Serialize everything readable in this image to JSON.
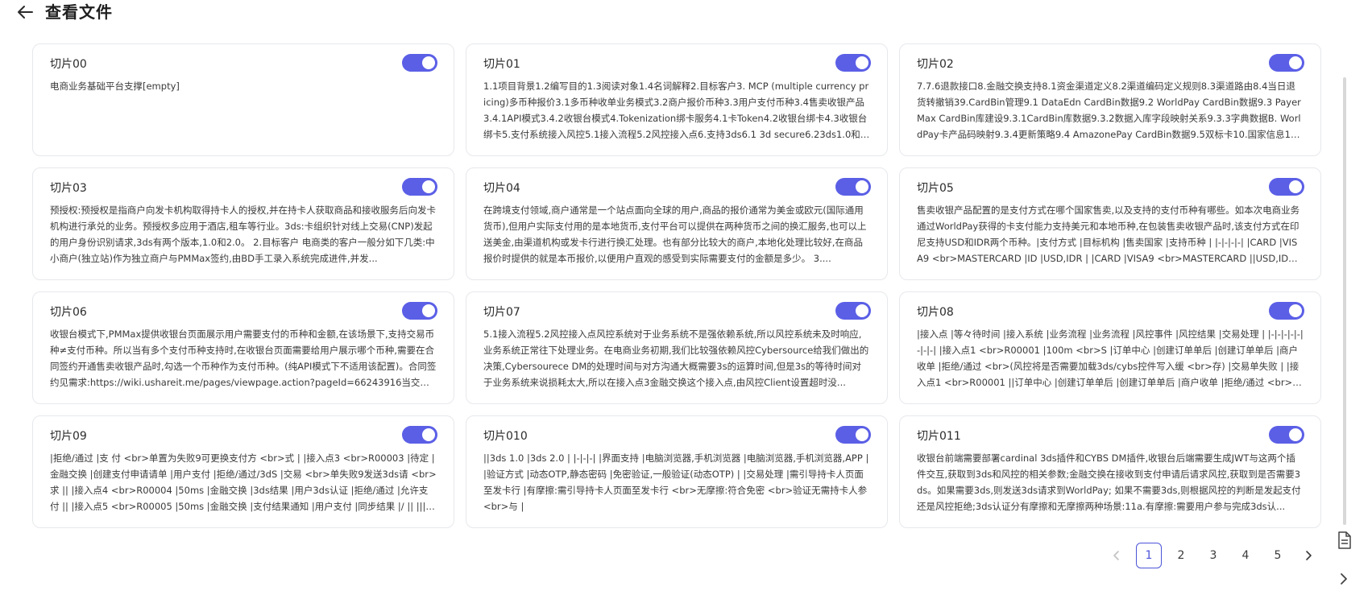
{
  "header": {
    "title": "查看文件"
  },
  "cards": [
    {
      "title": "切片00",
      "enabled": true,
      "text": "电商业务基础平台支撑[empty]"
    },
    {
      "title": "切片01",
      "enabled": true,
      "text": "1.1项目背景1.2编写目的1.3阅读对象1.4名词解释2.目标客户3. MCP (multiple currency pricing)多币种报价3.1多币种收单业务模式3.2商户报价币种3.3用户支付币种3.4售卖收银产品3.4.1API模式3.4.2收银台模式4.Tokenization绑卡服务4.1卡Token4.2收银台绑卡4.3收银台绑卡5.支付系统接入风控5.1接入流程5.2风控接入点6.支持3ds6.1 3d secure6.23ds1.0和2...."
    },
    {
      "title": "切片02",
      "enabled": true,
      "text": "7.7.6退款接口8.金融交换支持8.1资金渠道定义8.2渠道编码定义规则8.3渠道路由8.4当日退货转撤销39.CardBin管理9.1 DataEdn CardBin数据9.2 WorldPay CardBin数据9.3 PayerMax CardBin库建设9.3.1CardBin库数据9.3.2数据入库字段映射关系9.3.3字典数据B. WorldPay卡产品码映射9.3.4更新策略9.4 AmazonePay CardBin数据9.5双标卡10.国家信息10.1国家代..."
    },
    {
      "title": "切片03",
      "enabled": true,
      "text": "预授权:预授权是指商户向发卡机构取得持卡人的授权,并在持卡人获取商品和接收服务后向发卡机构进行承兑的业务。预授权多应用于酒店,租车等行业。3ds:卡组织针对线上交易(CNP)发起的用户身份识别请求,3ds有两个版本,1.0和2.0。 2.目标客户 电商类的客户一般分如下几类:中小商户(独立站)作为独立商户与PMMax签约,由BD手工录入系统完成进件,并发..."
    },
    {
      "title": "切片04",
      "enabled": true,
      "text": "在跨境支付领域,商户通常是一个站点面向全球的用户,商品的报价通常为美金或欧元(国际通用货币),但用户实际支付用的是本地货币,支付平台可以提供在两种货币之间的换汇服务,也可以上送美金,由渠道机构或发卡行进行换汇处理。也有部分比较大的商户,本地化处理比较好,在商品报价时提供的就是本币报价,以便用户直观的感受到实际需要支付的金额是多少。 3...."
    },
    {
      "title": "切片05",
      "enabled": true,
      "text": "售卖收银产品配置的是支付方式在哪个国家售卖,以及支持的支付币种有哪些。如本次电商业务通过WorldPay获得的卡支付能力支持美元和本地币种,在包装售卖收银产品时,该支付方式在印尼支持USD和IDR两个币种。|支付方式 |目标机构 |售卖国家 |支持币种 | |-|-|-|-| |CARD |VISA9 <br>MASTERCARD |ID |USD,IDR | |CARD |VISA9 <br>MASTERCARD ||USD,IDR |..."
    },
    {
      "title": "切片06",
      "enabled": true,
      "text": "收银台模式下,PMMax提供收银台页面展示用户需要支付的币种和金额,在该场景下,支持交易币种≠支付币种。所以当有多个支付币种支持时,在收银台页面需要给用户展示哪个币种,需要在合同签约开通售卖收银产品时,勾选一个币种作为支付币种。(纯API模式下不适用该配置)。合同签约见需求:https://wiki.ushareit.me/pages/viewpage.action?pageId=66243916当交易..."
    },
    {
      "title": "切片07",
      "enabled": true,
      "text": "5.1接入流程5.2风控接入点风控系统对于业务系统不是强依赖系统,所以风控系统未及时响应,业务系统正常往下处理业务。在电商业务初期,我们比较强依赖风控Cybersource给我们做出的决策,Cybersourece DM的处理时间与对方沟通大概需要3s的运算时间,但是3s的等待时间对于业务系统来说损耗太大,所以在接入点3金融交换这个接入点,由风控Client设置超时没..."
    },
    {
      "title": "切片08",
      "enabled": true,
      "text": "|接入点 |等々待时间 |接入系统 |业务流程 |业务流程 |风控事件 |风控结果 |交易处理 | |-|-|-|-|-|-|-|-| |接入点1 <br>R00001 |100m <br>S |订单中心 |创建订单单后 |创建订单单后 |商户收单 |拒绝/通过 <br>(风控将是否需要加载3ds/cybs控件写入缓 <br>存) |交易单失败 | |接入点1 <br>R00001 ||订单中心 |创建订单单后 |创建订单单后 |商户收单 |拒绝/通过 <br>(风控将是..."
    },
    {
      "title": "切片09",
      "enabled": true,
      "text": "|拒绝/通过 |支 付 <br>单置为失败9可更换支付方 <br>式 | |接入点3 <br>R00003 |待定 |金融交换 |创建支付申请请单 |用户支付 |拒绝/通过/3dS |交易 <br>单失败9发送3ds请 <br>求 || |接入点4 <br>R00004 |50ms |金融交换 |3ds结果 |用户3ds认证 |拒绝/通过 |允许支付 || |接入点5 <br>R00005 |50ms |金融交换 |支付结果通知 |用户支付 |同步结果 |/ || |||/ |金副交换通..."
    },
    {
      "title": "切片010",
      "enabled": true,
      "text": "||3ds 1.0 |3ds 2.0 | |-|-|-| |界面支持 |电脑浏览器,手机浏览器 |电脑浏览器,手机浏览器,APP | |验证方式 |动态OTP,静态密码 |免密验证,一般验证(动态OTP) | |交易处理 |需引导持卡人页面至发卡行 |有摩擦:需引导持卡人页面至发卡行 <br>无摩擦:符合免密 <br>验证无需持卡人参<br>与 |"
    },
    {
      "title": "切片011",
      "enabled": true,
      "text": "收银台前端需要部署cardinal 3ds插件和CYBS DM插件,收银台后端需要生成JWT与这两个插件交互,获取到3ds和风控的相关参数;金融交换在接收到支付申请后请求风控,获取到是否需要3ds。如果需要3ds,则发送3ds请求到WorldPay; 如果不需要3ds,则根据风控的判断是发起支付还是风控拒绝;3ds认证分有摩擦和无摩擦两种场景:11a.有摩擦:需要用户参与完成3ds认..."
    }
  ],
  "pagination": {
    "pages": [
      "1",
      "2",
      "3",
      "4",
      "5"
    ],
    "current": "1"
  }
}
